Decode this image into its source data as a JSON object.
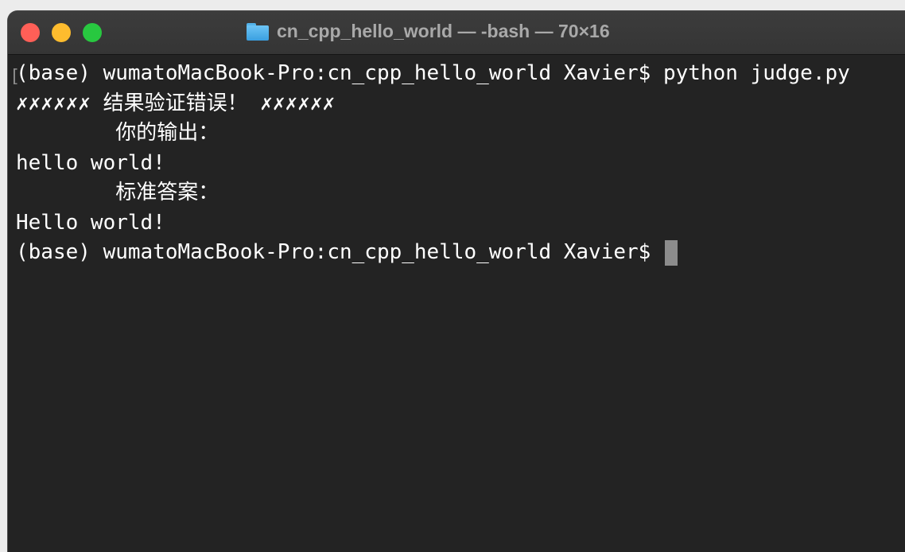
{
  "window": {
    "title": "cn_cpp_hello_world — -bash — 70×16",
    "folder_icon": "folder-icon",
    "traffic_lights": [
      {
        "name": "close",
        "color": "#ff5f57"
      },
      {
        "name": "minimize",
        "color": "#febc2e"
      },
      {
        "name": "zoom",
        "color": "#28c840"
      }
    ]
  },
  "terminal": {
    "lines": [
      "(base) wumatoMacBook-Pro:cn_cpp_hello_world Xavier$ python judge.py",
      "✗✗✗✗✗✗ 结果验证错误！ ✗✗✗✗✗✗",
      "        你的输出：",
      "hello world!",
      "        标准答案：",
      "Hello world!",
      "(base) wumatoMacBook-Pro:cn_cpp_hello_world Xavier$ "
    ],
    "background": "#232323",
    "foreground": "#ffffff"
  }
}
